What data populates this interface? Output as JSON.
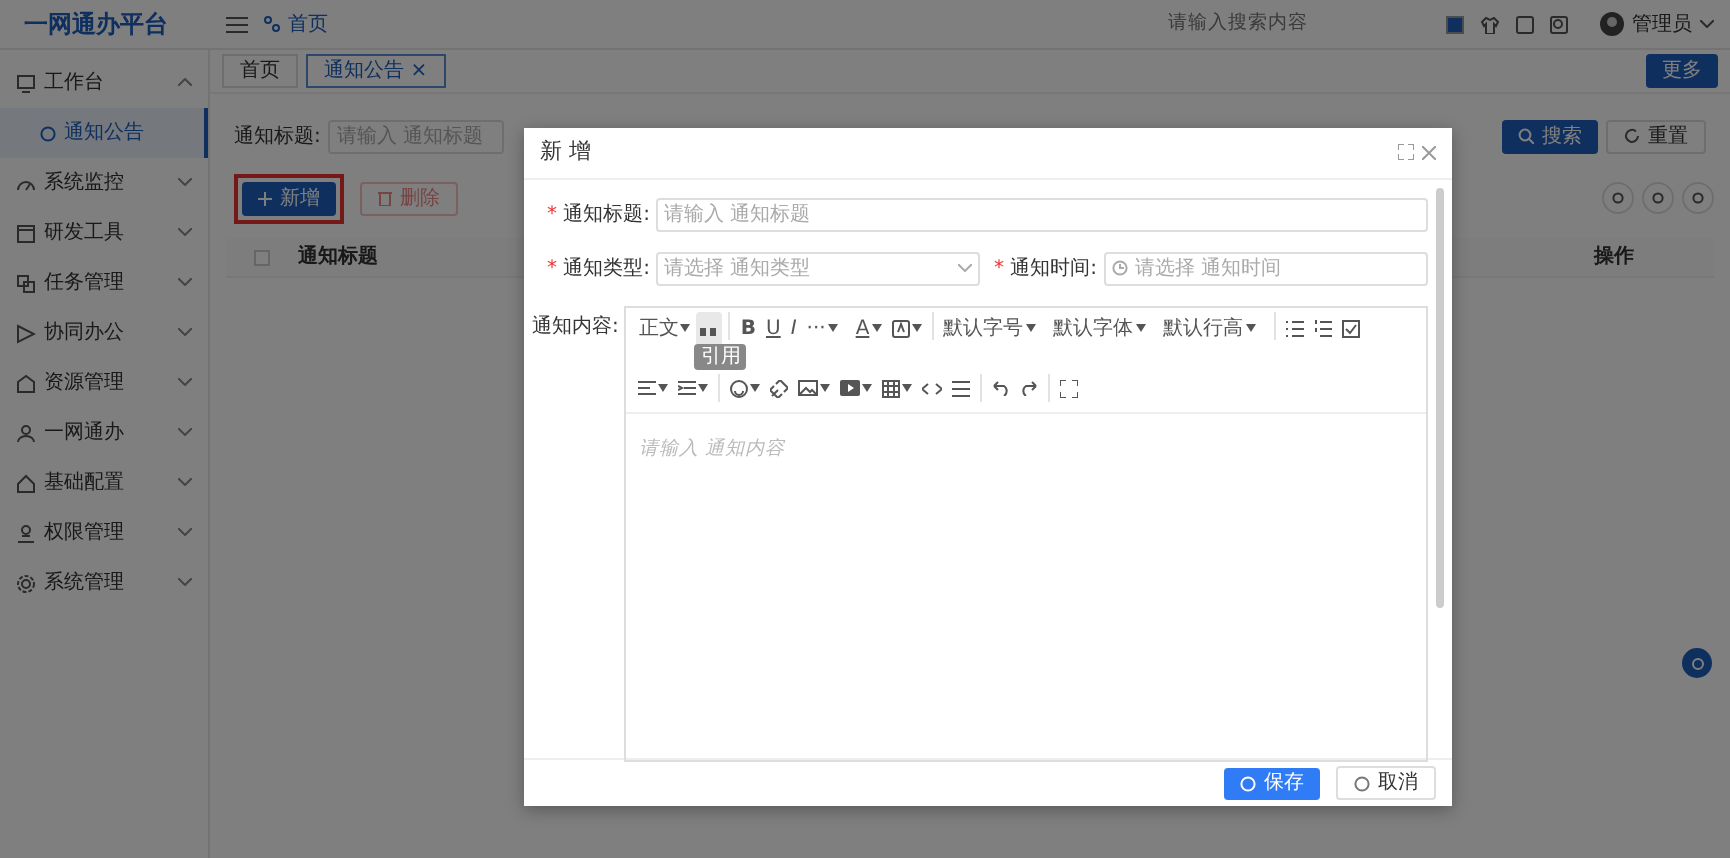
{
  "header": {
    "logo": "一网通办平台",
    "breadcrumb": "首页",
    "search": {
      "placeholder": "请输入搜索内容"
    },
    "user": "管理员"
  },
  "sidebar": {
    "items": [
      {
        "label": "工作台",
        "expanded": true,
        "children": [
          {
            "label": "通知公告",
            "selected": true
          }
        ]
      },
      {
        "label": "系统监控",
        "expanded": false
      },
      {
        "label": "研发工具",
        "expanded": false
      },
      {
        "label": "任务管理",
        "expanded": false
      },
      {
        "label": "协同办公",
        "expanded": false
      },
      {
        "label": "资源管理",
        "expanded": false
      },
      {
        "label": "一网通办",
        "expanded": false
      },
      {
        "label": "基础配置",
        "expanded": false
      },
      {
        "label": "权限管理",
        "expanded": false
      },
      {
        "label": "系统管理",
        "expanded": false
      }
    ]
  },
  "tabs": [
    {
      "label": "首页",
      "selected": false
    },
    {
      "label": "通知公告",
      "selected": true,
      "close": "×"
    }
  ],
  "more_button": "更多",
  "filter": {
    "label": "通知标题:",
    "placeholder": "请输入 通知标题",
    "search_button": "搜索",
    "reset_button": "重置"
  },
  "actions": {
    "add": {
      "label": "新增",
      "highlighted": true
    },
    "delete": {
      "label": "删除",
      "disabled": true
    }
  },
  "table": {
    "columns": [
      "通知标题",
      "操作"
    ],
    "checked": false
  },
  "dialog": {
    "title": "新 增",
    "fields": [
      {
        "kind": "input",
        "mark": "*",
        "label": "通知标题:",
        "placeholder": "请输入 通知标题"
      },
      {
        "kind": "select",
        "mark": "*",
        "label": "通知类型:",
        "placeholder": "请选择 通知类型"
      },
      {
        "kind": "time",
        "mark": "*",
        "label": "通知时间:",
        "placeholder": "请选择 通知时间"
      },
      {
        "kind": "editor",
        "label": "通知内容:",
        "placeholder": "请输入 通知内容"
      }
    ],
    "editor_toolbar": [
      [
        {
          "kind": "text",
          "label": "正文",
          "caret": true
        },
        {
          "kind": "quote",
          "active": true
        },
        {
          "kind": "divider"
        },
        {
          "kind": "bold",
          "label": "B"
        },
        {
          "kind": "underline",
          "label": "U"
        },
        {
          "kind": "italic",
          "label": "I"
        },
        {
          "kind": "text",
          "label": "···",
          "caret": true
        },
        {
          "kind": "fontcolor",
          "label": "A",
          "caret": true
        },
        {
          "kind": "bgcolor",
          "caret": true
        },
        {
          "kind": "divider"
        },
        {
          "kind": "text",
          "label": "默认字号",
          "caret": true
        },
        {
          "kind": "text",
          "label": "默认字体",
          "caret": true
        },
        {
          "kind": "text",
          "label": "默认行高",
          "caret": true
        },
        {
          "kind": "divider"
        },
        {
          "kind": "bullets"
        },
        {
          "kind": "numbers"
        },
        {
          "kind": "todo"
        }
      ],
      [
        {
          "kind": "align",
          "caret": true
        },
        {
          "kind": "indent",
          "caret": true
        },
        {
          "kind": "divider"
        },
        {
          "kind": "emoji",
          "caret": true
        },
        {
          "kind": "link"
        },
        {
          "kind": "image",
          "caret": true
        },
        {
          "kind": "video",
          "caret": true
        },
        {
          "kind": "table",
          "caret": true
        },
        {
          "kind": "code"
        },
        {
          "kind": "rule"
        },
        {
          "kind": "divider"
        },
        {
          "kind": "undo"
        },
        {
          "kind": "redo"
        },
        {
          "kind": "divider"
        },
        {
          "kind": "fullscreen"
        }
      ]
    ],
    "tooltip": "引用",
    "buttons": [
      {
        "kind": "primary",
        "label": "保存"
      },
      {
        "kind": "default",
        "label": "取消"
      }
    ]
  }
}
